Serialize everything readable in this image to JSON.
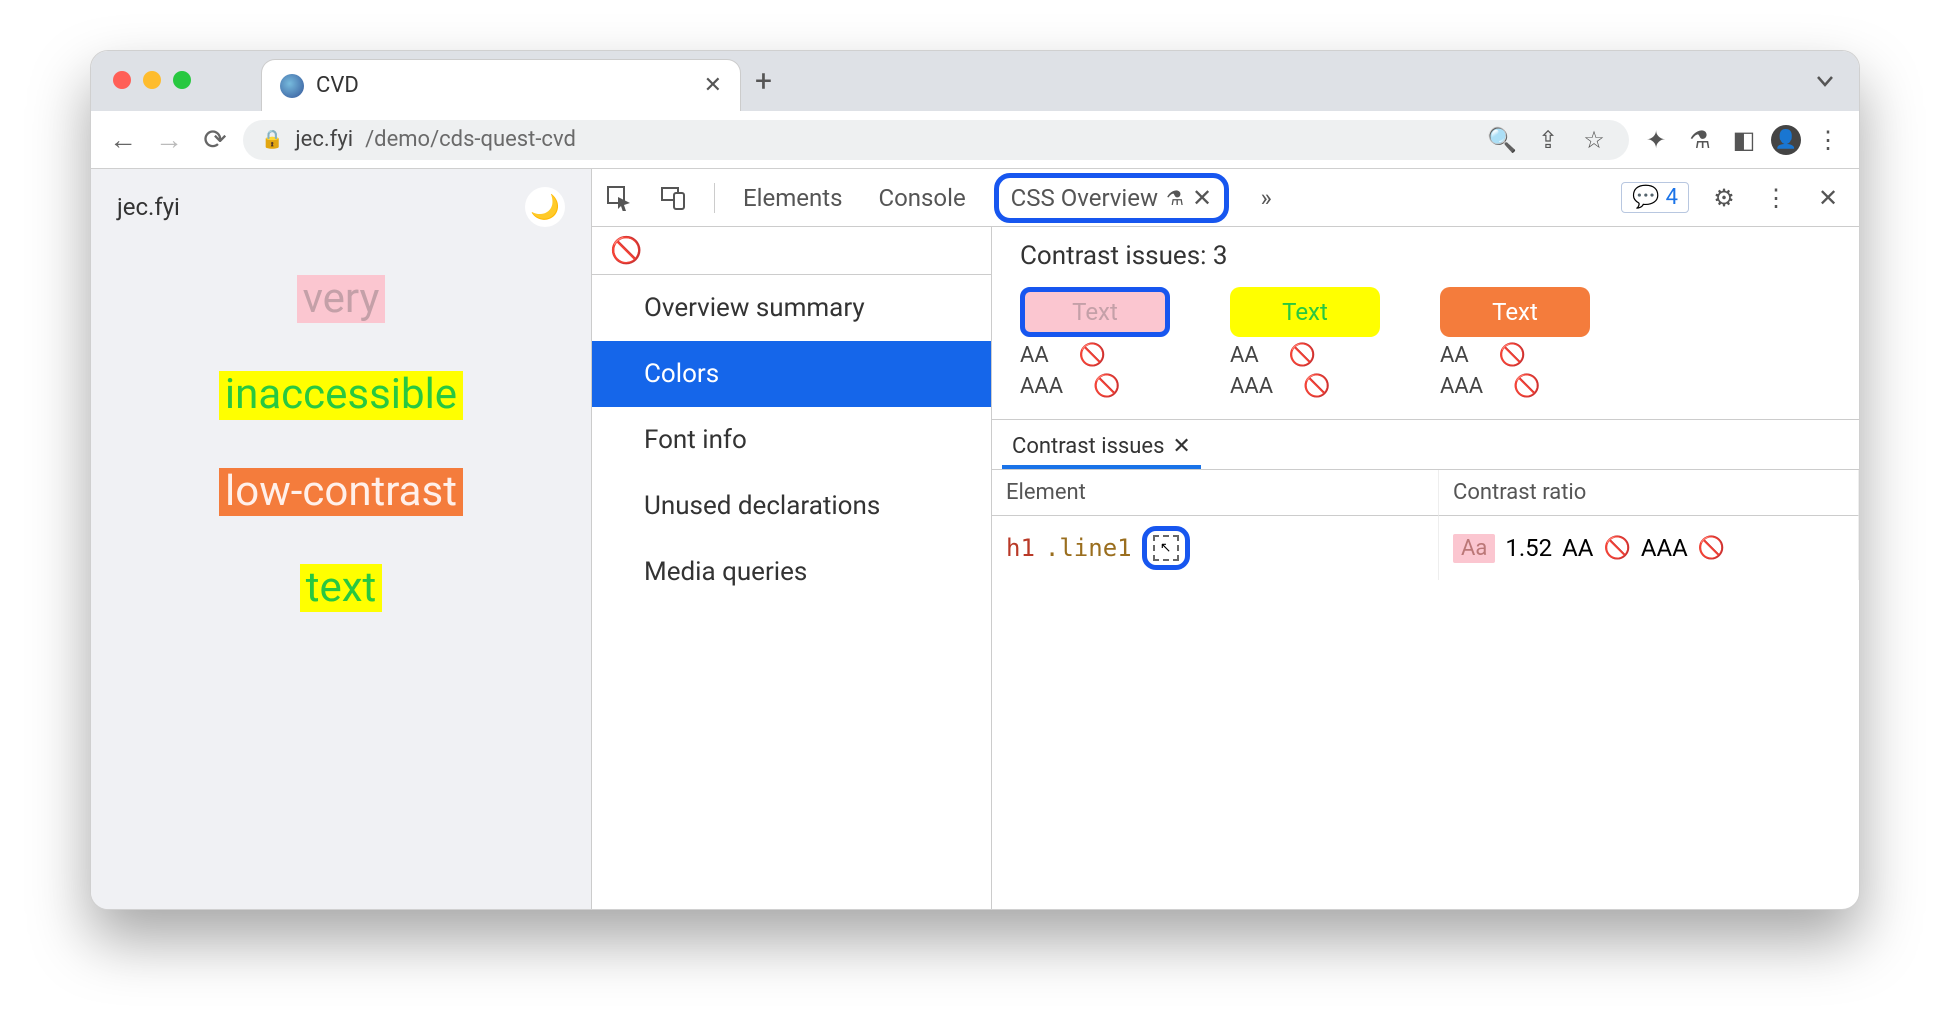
{
  "browser": {
    "tab_title": "CVD",
    "url_host": "jec.fyi",
    "url_path": "/demo/cds-quest-cvd"
  },
  "page": {
    "site_label": "jec.fyi",
    "words": [
      "very",
      "inaccessible",
      "low-contrast",
      "text"
    ]
  },
  "devtools": {
    "tabs": {
      "elements": "Elements",
      "console": "Console",
      "css_overview": "CSS Overview"
    },
    "issues_count": "4",
    "sidebar": {
      "items": [
        "Overview summary",
        "Colors",
        "Font info",
        "Unused declarations",
        "Media queries"
      ],
      "active_index": 1
    },
    "contrast_issues_title": "Contrast issues: 3",
    "swatches": [
      {
        "label": "Text",
        "aa": "AA",
        "aaa": "AAA"
      },
      {
        "label": "Text",
        "aa": "AA",
        "aaa": "AAA"
      },
      {
        "label": "Text",
        "aa": "AA",
        "aaa": "AAA"
      }
    ],
    "issues_table": {
      "tab_label": "Contrast issues",
      "cols": {
        "element": "Element",
        "ratio": "Contrast ratio"
      },
      "row": {
        "tag": "h1",
        "cls": ".line1",
        "chip": "Aa",
        "ratio": "1.52",
        "aa": "AA",
        "aaa": "AAA"
      }
    }
  }
}
